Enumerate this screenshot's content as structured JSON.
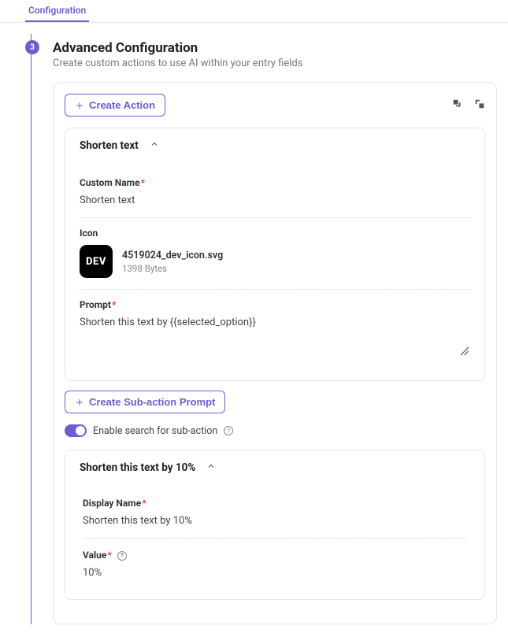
{
  "tab": {
    "label": "Configuration"
  },
  "step": {
    "number": "3"
  },
  "section": {
    "title": "Advanced Configuration",
    "desc": "Create custom actions to use AI within your entry fields"
  },
  "actions": {
    "create_action_label": "Create Action",
    "item": {
      "title": "Shorten text",
      "custom_name_label": "Custom Name",
      "custom_name_value": "Shorten text",
      "icon_label": "Icon",
      "icon_filename": "4519024_dev_icon.svg",
      "icon_filesize": "1398 Bytes",
      "icon_glyph": "DEV",
      "prompt_label": "Prompt",
      "prompt_value": "Shorten this text by {{selected_option}}"
    },
    "create_subaction_label": "Create Sub-action Prompt",
    "enable_search_label": "Enable search for sub-action",
    "subaction": {
      "title": "Shorten this text by 10%",
      "display_name_label": "Display Name",
      "display_name_value": "Shorten this text by 10%",
      "value_label": "Value",
      "value_value": "10%"
    }
  }
}
